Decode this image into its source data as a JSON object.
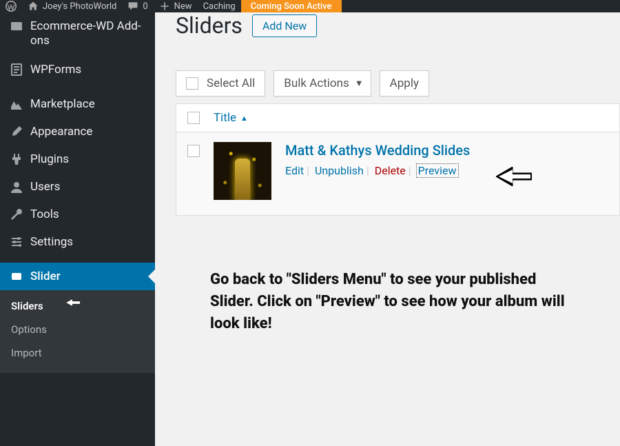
{
  "adminbar": {
    "site_name": "Joey's PhotoWorld",
    "comments_count": "0",
    "new_label": "New",
    "caching_label": "Caching",
    "coming_soon": "Coming Soon Active"
  },
  "sidebar": {
    "items": [
      {
        "label": "Ecommerce-WD Add-ons"
      },
      {
        "label": "WPForms"
      },
      {
        "label": "Marketplace"
      },
      {
        "label": "Appearance"
      },
      {
        "label": "Plugins"
      },
      {
        "label": "Users"
      },
      {
        "label": "Tools"
      },
      {
        "label": "Settings"
      },
      {
        "label": "Slider"
      }
    ],
    "submenu": {
      "sliders": "Sliders",
      "options": "Options",
      "import": "Import"
    }
  },
  "page": {
    "title": "Sliders",
    "add_new": "Add New",
    "select_all": "Select All",
    "bulk_actions": "Bulk Actions",
    "apply": "Apply",
    "col_title": "Title"
  },
  "row": {
    "title": "Matt & Kathys Wedding Slides",
    "edit": "Edit",
    "unpublish": "Unpublish",
    "delete": "Delete",
    "preview": "Preview"
  },
  "instruction_text": "Go back to \"Sliders Menu\" to see your published Slider. Click on \"Preview\" to see how your album will look like!"
}
